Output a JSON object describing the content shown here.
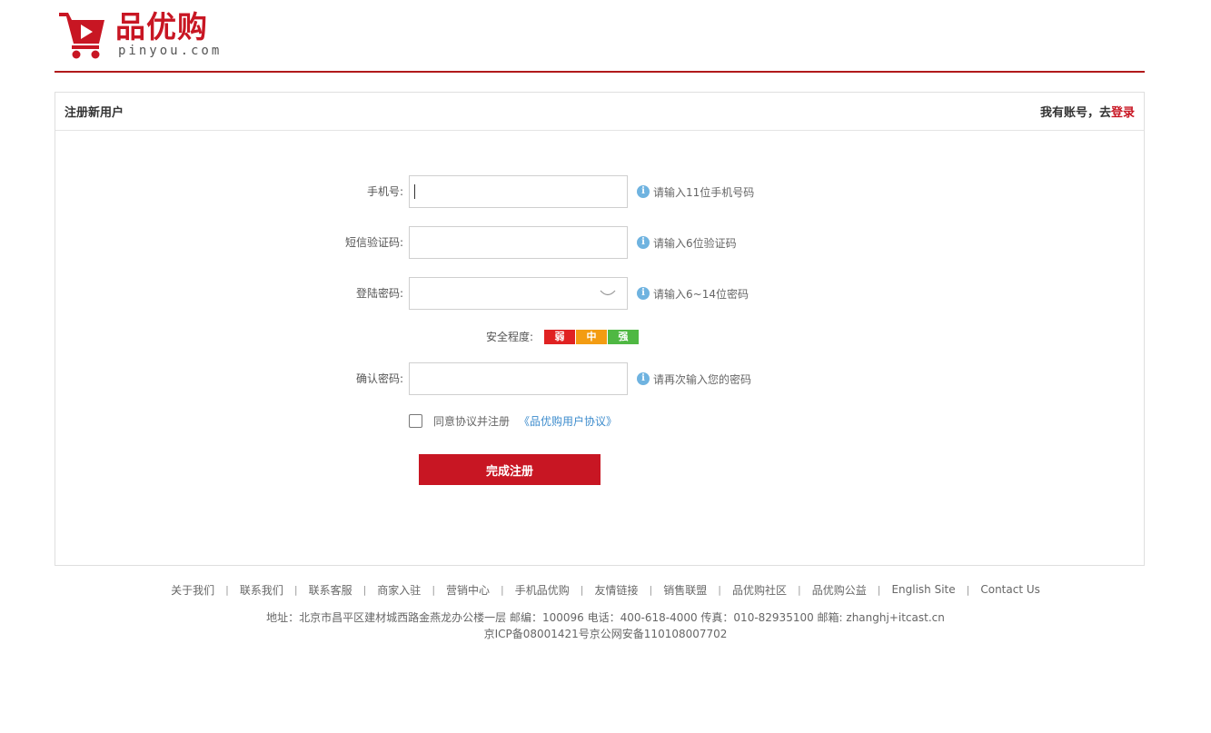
{
  "brand": {
    "name_cn": "品优购",
    "domain": "pinyou.com",
    "accent_color": "#c81623"
  },
  "panel": {
    "title": "注册新用户",
    "login_prompt": "我有账号，去",
    "login_link": "登录"
  },
  "form": {
    "phone": {
      "label": "手机号:",
      "hint": "请输入11位手机号码",
      "value": ""
    },
    "sms_code": {
      "label": "短信验证码:",
      "hint": "请输入6位验证码",
      "value": ""
    },
    "password": {
      "label": "登陆密码:",
      "hint": "请输入6~14位密码",
      "value": ""
    },
    "strength": {
      "label": "安全程度:",
      "levels": [
        {
          "text": "弱",
          "color": "#e02222"
        },
        {
          "text": "中",
          "color": "#f39c12"
        },
        {
          "text": "强",
          "color": "#4fb843"
        }
      ]
    },
    "confirm": {
      "label": "确认密码:",
      "hint": "请再次输入您的密码",
      "value": ""
    },
    "agree_text": "同意协议并注册",
    "agreement_link": "《品优购用户协议》",
    "submit_label": "完成注册",
    "info_glyph": "i"
  },
  "footer": {
    "links": [
      "关于我们",
      "联系我们",
      "联系客服",
      "商家入驻",
      "营销中心",
      "手机品优购",
      "友情链接",
      "销售联盟",
      "品优购社区",
      "品优购公益",
      "English Site",
      "Contact Us"
    ],
    "separator": "|",
    "address": "地址：北京市昌平区建材城西路金燕龙办公楼一层 邮编：100096 电话：400-618-4000 传真：010-82935100 邮箱: zhanghj+itcast.cn",
    "icp": "京ICP备08001421号京公网安备110108007702"
  },
  "icons": {
    "logo": "shopping-cart-play-icon",
    "info": "info-icon",
    "eye": "eye-closed-icon"
  }
}
